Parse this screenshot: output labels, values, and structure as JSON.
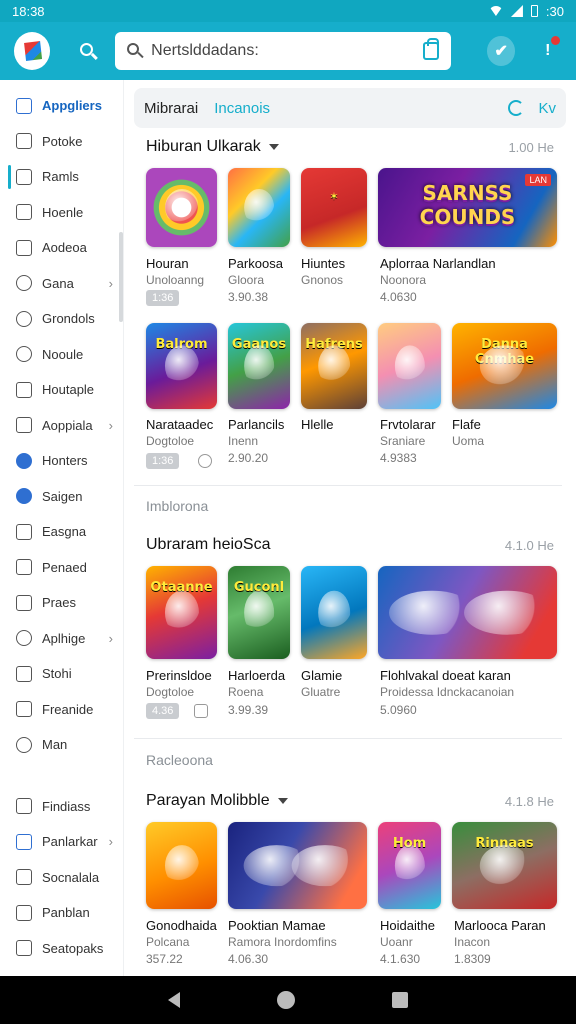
{
  "status": {
    "time": "18:38",
    "right": ":30"
  },
  "search": {
    "value": "Nertslddadans:"
  },
  "sidebar": {
    "items": [
      {
        "label": "Appgliers"
      },
      {
        "label": "Potoke"
      },
      {
        "label": "Ramls"
      },
      {
        "label": "Hoenle"
      },
      {
        "label": "Aodeoa"
      },
      {
        "label": "Gana"
      },
      {
        "label": "Grondols"
      },
      {
        "label": "Nooule"
      },
      {
        "label": "Houtaple"
      },
      {
        "label": "Aoppiala"
      },
      {
        "label": "Honters"
      },
      {
        "label": "Saigen"
      },
      {
        "label": "Easgna"
      },
      {
        "label": "Penaed"
      },
      {
        "label": "Praes"
      },
      {
        "label": "Aplhige"
      },
      {
        "label": "Stohi"
      },
      {
        "label": "Freanide"
      },
      {
        "label": "Man"
      },
      {
        "label": "Findiass"
      },
      {
        "label": "Panlarkar"
      },
      {
        "label": "Socnalala"
      },
      {
        "label": "Panblan"
      },
      {
        "label": "Seatopaks"
      }
    ]
  },
  "tabs": {
    "first": "Mibrarai",
    "second": "Incanois",
    "right_label": "Kv"
  },
  "sections": [
    {
      "title": "Hiburan Ulkarak",
      "meta": "1.00 He",
      "row1": [
        {
          "name": "Houran",
          "sub": "Unoloanng",
          "num": "",
          "chip": "1:36"
        },
        {
          "name": "Parkoosa",
          "sub": "Gloora",
          "num": "3.90.38"
        },
        {
          "name": "Hiuntes",
          "sub": "Gnonos"
        },
        {
          "name": "Aplorraa Narlandlan",
          "sub": "Noonora",
          "num": "4.0630",
          "banner": "SARNSS COUNDS",
          "badge": "LAN"
        }
      ],
      "row2": [
        {
          "name": "Narataadec",
          "sub": "Dogtoloe",
          "chip": "1:36",
          "tile_text": "Balrom"
        },
        {
          "name": "Parlancils",
          "sub": "Inenn",
          "num": "2.90.20",
          "tile_text": "Gaanos"
        },
        {
          "name": "Hlelle",
          "tile_text": "Hafrens"
        },
        {
          "name": "Frvtolarar",
          "sub": "Sraniare",
          "num": "4.9383"
        },
        {
          "name": "Flafe",
          "sub": "Uoma",
          "tile_text": "Danna Cnmhae"
        }
      ]
    },
    {
      "muted": "Imblorona",
      "title": "Ubraram heioSca",
      "meta": "4.1.0 He",
      "apps": [
        {
          "name": "Prerinsldoe",
          "sub": "Dogtoloe",
          "chip": "4.36",
          "tile_text": "Otaanne"
        },
        {
          "name": "Harloerda",
          "sub": "Roena",
          "num": "3.99.39",
          "tile_text": "Guconl"
        },
        {
          "name": "Glamie",
          "sub": "Gluatre"
        },
        {
          "name": "Flohlvakal doeat karan",
          "sub": "Proidessa Idnckacanoian",
          "num": "5.0960"
        }
      ]
    },
    {
      "muted": "Racleoona",
      "title": "Parayan Molibble",
      "meta": "4.1.8 He",
      "apps": [
        {
          "name": "Gonodhaida",
          "sub": "Polcana",
          "num": "357.22"
        },
        {
          "name": "Pooktian Mamae",
          "sub": "Ramora Inordomfins",
          "num": "4.06.30"
        },
        {
          "name": "Hoidaithe",
          "sub": "Uoanr",
          "num": "4.1.630",
          "tile_text": "Hom"
        },
        {
          "name": "Marlooca Paran",
          "sub": "Inacon",
          "num": "1.8309",
          "tile_text": "Rinnaas"
        }
      ]
    }
  ],
  "colors": {
    "accent": "#16aecb",
    "link": "#1565c0"
  }
}
